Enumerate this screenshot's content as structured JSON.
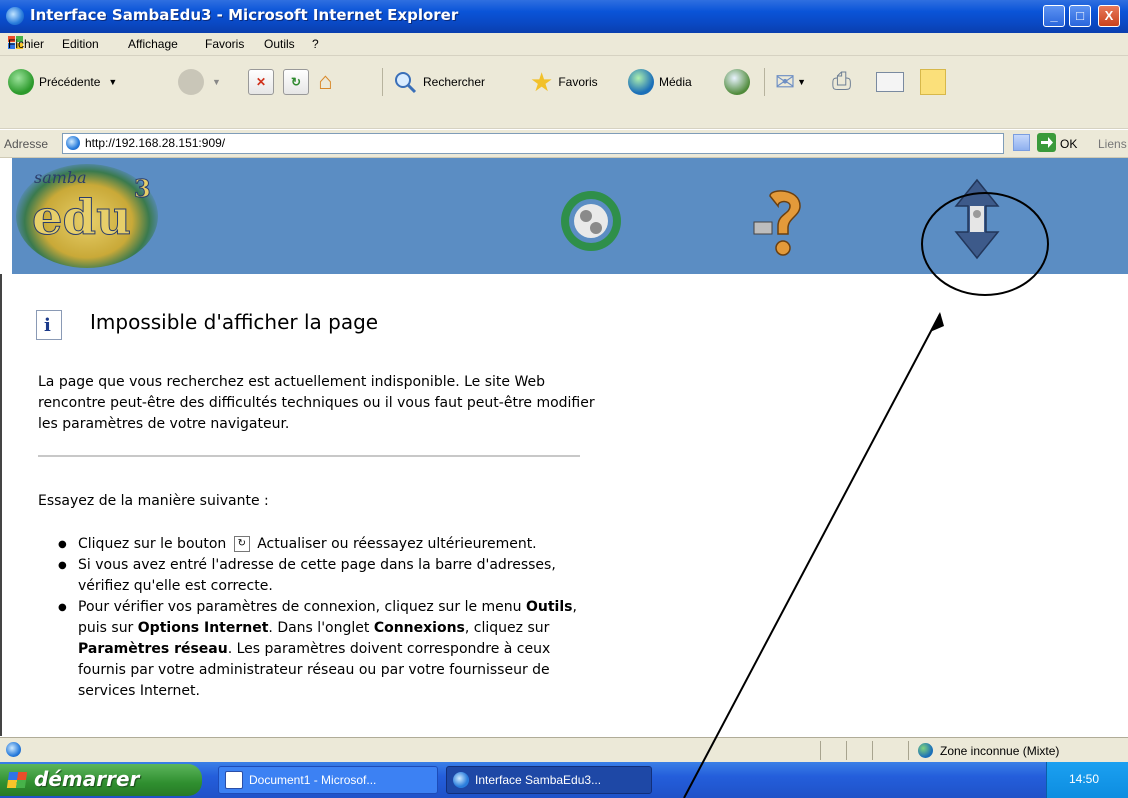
{
  "window": {
    "title": "Interface SambaEdu3 - Microsoft Internet Explorer",
    "controls": {
      "minimize": "_",
      "maximize": "□",
      "close": "X"
    }
  },
  "menu": [
    "Fichier",
    "Edition",
    "Affichage",
    "Favoris",
    "Outils",
    "?"
  ],
  "toolbar": {
    "back": "Précédente",
    "search": "Rechercher",
    "favorites": "Favoris",
    "media": "Média"
  },
  "address": {
    "label": "Adresse",
    "url": "http://192.168.28.151:909/",
    "go": "OK",
    "links": "Liens"
  },
  "banner": {
    "logo_top": "samba",
    "logo_main": "edu",
    "logo_sup": "3"
  },
  "error_page": {
    "title": "Impossible d'afficher la page",
    "intro": "La page que vous recherchez est actuellement indisponible. Le site Web rencontre peut-être des difficultés techniques ou il vous faut peut-être modifier les paramètres de votre navigateur.",
    "try_heading": "Essayez de la manière suivante :",
    "item1_a": "Cliquez sur le bouton",
    "item1_b": "Actualiser ou réessayez ultérieurement.",
    "item2": "Si vous avez entré l'adresse de cette page dans la barre d'adresses, vérifiez qu'elle est correcte.",
    "item3_a": "Pour vérifier vos paramètres de connexion, cliquez sur le menu",
    "item3_outils": "Outils",
    "item3_b": ", puis sur",
    "item3_options": "Options Internet",
    "item3_c": ". Dans l'onglet",
    "item3_connexions": "Connexions",
    "item3_d": ", cliquez sur",
    "item3_params": "Paramètres réseau",
    "item3_e": ". Les paramètres doivent correspondre à ceux fournis par votre administrateur réseau ou par votre fournisseur de services Internet."
  },
  "status": {
    "zone": "Zone inconnue (Mixte)"
  },
  "taskbar": {
    "start": "démarrer",
    "tasks": [
      "Document1 - Microsof...",
      "Interface SambaEdu3..."
    ],
    "clock": "14:50"
  },
  "colors": {
    "banner": "#5b8dc3",
    "titlebar": "#0a54d8",
    "chrome": "#ece9d8",
    "start_button": "#2f8f2f"
  }
}
